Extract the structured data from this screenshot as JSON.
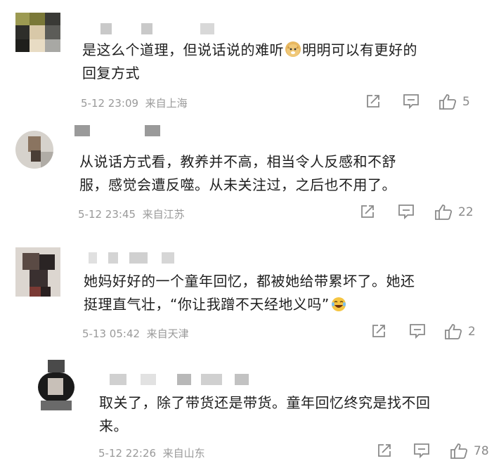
{
  "comments": [
    {
      "text_line1": "是这么个道理，但说话说的难听",
      "text_line1b": "明明可以有更好的",
      "text_line2": "回复方式",
      "timestamp": "5-12 23:09",
      "location": "来自上海",
      "like_count": "5",
      "emoji_icon": "doge-emoji-icon"
    },
    {
      "text_line1": "从说话方式看，教养并不高，相当令人反感和不舒",
      "text_line2": "服，感觉会遭反噬。从未关注过，之后也不用了。",
      "timestamp": "5-12 23:45",
      "location": "来自江苏",
      "like_count": "22"
    },
    {
      "text_line1": "她妈好好的一个童年回忆，都被她给带累坏了。她还",
      "text_line2": "挺理直气壮，“你让我蹭不天经地义吗”",
      "timestamp": "5-13 05:42",
      "location": "来自天津",
      "like_count": "2",
      "emoji_icon": "laugh-cry-emoji-icon"
    },
    {
      "text_line1": "取关了，除了带货还是带货。童年回忆终究是找不回",
      "text_line2": "来。",
      "timestamp": "5-12 22:26",
      "location": "来自山东",
      "like_count": "78"
    }
  ],
  "icons": {
    "share": "share-icon",
    "reply": "comment-icon",
    "like": "thumbs-up-icon"
  },
  "colors": {
    "meta_text": "#9a9a9a",
    "icon": "#8a8a8a",
    "body_text": "#1e1e1e",
    "redaction": "#c9c9c9"
  }
}
